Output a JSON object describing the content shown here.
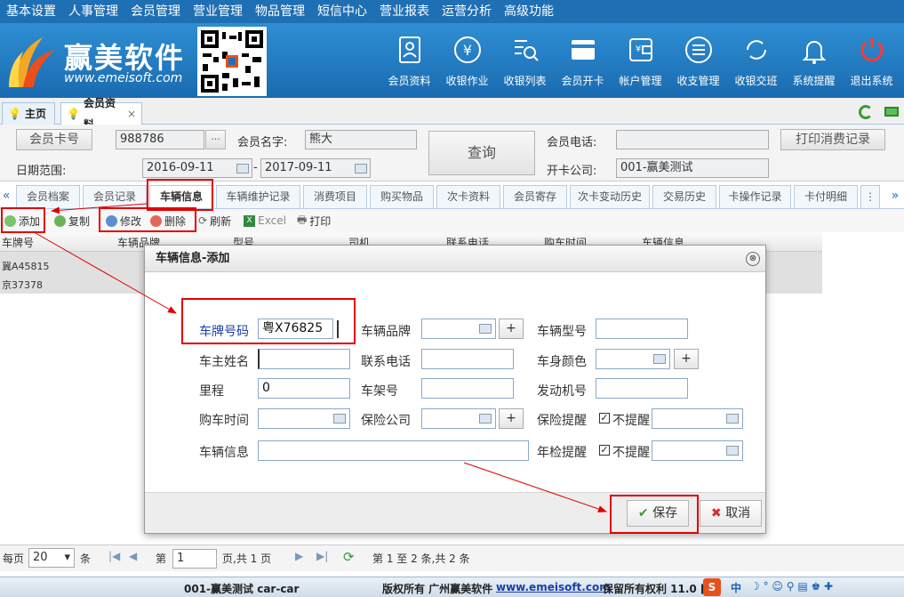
{
  "menu": [
    "基本设置",
    "人事管理",
    "会员管理",
    "营业管理",
    "物品管理",
    "短信中心",
    "营业报表",
    "运营分析",
    "高级功能"
  ],
  "brand": {
    "name": "赢美软件",
    "url": "www.emeisoft.com"
  },
  "tools": [
    {
      "label": "会员资料",
      "icon": "member-profile-icon"
    },
    {
      "label": "收银作业",
      "icon": "cashier-icon"
    },
    {
      "label": "收银列表",
      "icon": "cash-list-icon"
    },
    {
      "label": "会员开卡",
      "icon": "open-card-icon"
    },
    {
      "label": "帐户管理",
      "icon": "wallet-icon"
    },
    {
      "label": "收支管理",
      "icon": "ledger-icon"
    },
    {
      "label": "收银交班",
      "icon": "shift-handover-icon"
    },
    {
      "label": "系统提醒",
      "icon": "bell-icon"
    },
    {
      "label": "退出系统",
      "icon": "power-icon"
    }
  ],
  "page_tabs": [
    {
      "label": "主页"
    },
    {
      "label": "会员资料",
      "closable": "×"
    }
  ],
  "search": {
    "card_no_label": "会员卡号",
    "card_no": "988786",
    "ellipsis": "···",
    "name_label": "会员名字:",
    "name": "熊大",
    "query": "查询",
    "phone_label": "会员电话:",
    "phone": "",
    "print_btn": "打印消费记录",
    "date_label": "日期范围:",
    "date_from": "2016-09-11",
    "date_sep": "-",
    "date_to": "2017-09-11",
    "company_label": "开卡公司:",
    "company": "001-赢美测试"
  },
  "sub_tabs": [
    "会员档案",
    "会员记录",
    "车辆信息",
    "车辆维护记录",
    "消费项目",
    "购买物品",
    "次卡资料",
    "会员寄存",
    "次卡变动历史",
    "交易历史",
    "卡操作记录",
    "卡付明细"
  ],
  "sub_tabs_nav": {
    "left": "«",
    "right": "»",
    "more": "⋮"
  },
  "toolbar": {
    "add": "添加",
    "copy": "复制",
    "edit": "修改",
    "delete": "删除",
    "refresh": "刷新",
    "excel": "Excel",
    "print": "打印"
  },
  "grid": {
    "columns": [
      "车牌号",
      "车辆品牌",
      "型号",
      "司机",
      "联系电话",
      "购车时间",
      "车辆信息"
    ],
    "rows": [
      "冀A45815",
      "京37378"
    ]
  },
  "dialog": {
    "title": "车辆信息-添加",
    "close": "⊗",
    "plate_label": "车牌号码",
    "plate": "粤X76825",
    "brand_label": "车辆品牌",
    "brand_plus": "+",
    "model_label": "车辆型号",
    "owner_label": "车主姓名",
    "phone_label": "联系电话",
    "color_label": "车身颜色",
    "color_plus": "+",
    "mileage_label": "里程",
    "mileage": "0",
    "frame_label": "车架号",
    "engine_label": "发动机号",
    "buy_label": "购车时间",
    "insurer_label": "保险公司",
    "insurer_plus": "+",
    "ins_remind_label": "保险提醒",
    "no_remind": "不提醒",
    "check": "✓",
    "info_label": "车辆信息",
    "inspect_label": "年检提醒",
    "save": "保存",
    "cancel": "取消"
  },
  "pager": {
    "per_page_label": "每页",
    "per_page": "20",
    "unit": "条",
    "page_label": "第",
    "page": "1",
    "total_pages": "页,共 1 页",
    "summary": "第 1 至 2 条,共 2 条"
  },
  "status": {
    "company": "001-赢美测试 car-car",
    "copyright": "版权所有 广州赢美软件",
    "url": "www.emeisoft.com",
    "rights": "保留所有权利 11.0 [&",
    "ime": "中"
  },
  "colors": {
    "menu_bg": "#1f6fb5",
    "header_bg": "#2a82c8",
    "highlight": "#e00000"
  }
}
